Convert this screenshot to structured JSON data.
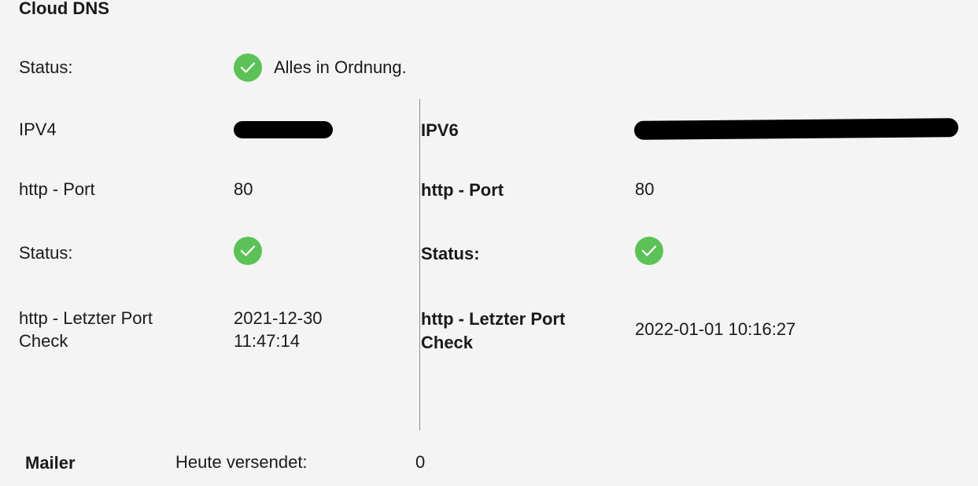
{
  "cloud_dns": {
    "title": "Cloud DNS",
    "status_label": "Status:",
    "status_text": "Alles in Ordnung.",
    "status_icon": "check-circle-icon"
  },
  "ipv4": {
    "label": "IPV4",
    "port_label": "http - Port",
    "port_value": "80",
    "status_label": "Status:",
    "last_check_label": "http - Letzter Port Check",
    "last_check_date": "2021-12-30",
    "last_check_time": "11:47:14"
  },
  "ipv6": {
    "label": "IPV6",
    "port_label": "http - Port",
    "port_value": "80",
    "status_label": "Status:",
    "last_check_label": "http - Letzter Port Check",
    "last_check_value": "2022-01-01 10:16:27"
  },
  "mailer": {
    "title": "Mailer",
    "sent_today_label": "Heute versendet:",
    "sent_today_value": "0"
  },
  "colors": {
    "success": "#5cc257",
    "background": "#f4f4f4",
    "divider": "#8c8c8c"
  }
}
